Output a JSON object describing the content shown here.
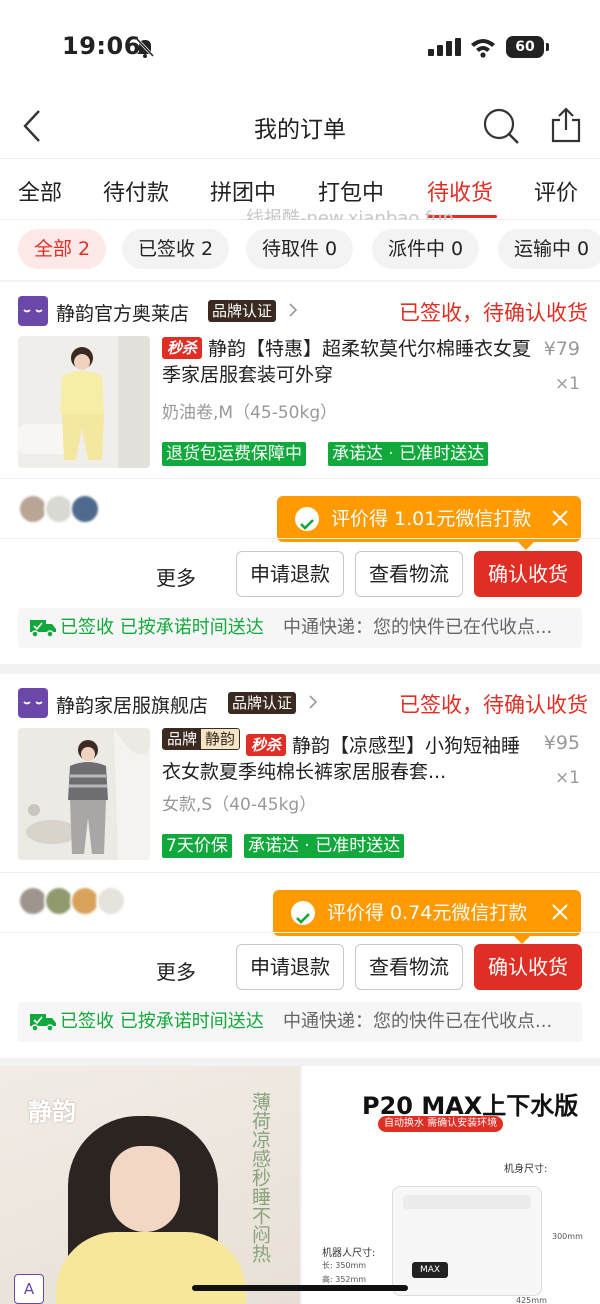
{
  "status_bar": {
    "time": "19:06",
    "battery": "60"
  },
  "nav": {
    "title": "我的订单"
  },
  "tabs": [
    "全部",
    "待付款",
    "拼团中",
    "打包中",
    "待收货",
    "评价"
  ],
  "active_tab": "待收货",
  "watermark": "线报酷-new.xianbao.fun",
  "chips": [
    "全部 2",
    "已签收 2",
    "待取件 0",
    "派件中 0",
    "运输中 0"
  ],
  "orders": [
    {
      "shop_name": "静韵官方奥莱店",
      "brand_badge": "品牌认证",
      "status": "已签收，待确认收货",
      "title_tags": [
        "秒杀"
      ],
      "title": "静韵【特惠】超柔软莫代尔棉睡衣女夏季家居服套装可外穿",
      "spec": "奶油卷,M（45-50kg）",
      "tags": [
        "退货包运费保障中",
        "承诺达 · 已准时送达"
      ],
      "price": "¥79",
      "qty": "×1",
      "tip": "评价得 1.01元微信打款",
      "more": "更多",
      "buttons": [
        "申请退款",
        "查看物流",
        "确认收货"
      ],
      "logistics_status": "已签收 已按承诺时间送达",
      "logistics_info": "中通快递：您的快件已在代收点..."
    },
    {
      "shop_name": "静韵家居服旗舰店",
      "brand_badge": "品牌认证",
      "status": "已签收，待确认收货",
      "brand_tag": [
        "品牌",
        "静韵"
      ],
      "title_tags": [
        "秒杀"
      ],
      "title": "静韵【凉感型】小狗短袖睡衣女款夏季纯棉长裤家居服春套...",
      "spec": "女款,S（40-45kg）",
      "tags": [
        "7天价保",
        "承诺达 · 已准时送达"
      ],
      "price": "¥95",
      "qty": "×1",
      "tip": "评价得 0.74元微信打款",
      "more": "更多",
      "buttons": [
        "申请退款",
        "查看物流",
        "确认收货"
      ],
      "logistics_status": "已签收 已按承诺时间送达",
      "logistics_info": "中通快递：您的快件已在代收点..."
    }
  ],
  "ad": {
    "left_brand": "静韵",
    "left_slogan": "薄荷凉感秒睡不闷热",
    "logo_tile": "A",
    "right_title": "P20 MAX上下水版",
    "right_sub": "自动换水 需确认安装环境",
    "size_label": "机身尺寸:",
    "height_label": "300mm",
    "robot_size_label": "机器人尺寸:",
    "robot_len": "长: 350mm",
    "robot_h": "高: 352mm",
    "robot_width": "425mm",
    "display": "MAX"
  },
  "colors": {
    "accent": "#e02e24",
    "green": "#11a83c",
    "tip": "#ff9a00"
  }
}
